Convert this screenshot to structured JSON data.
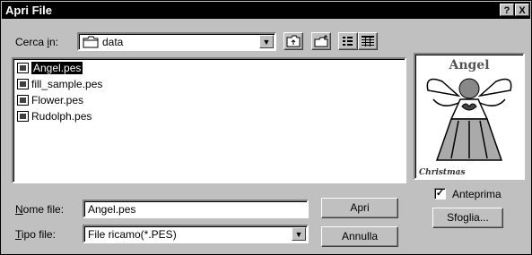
{
  "window": {
    "title": "Apri File",
    "help_label": "?",
    "close_label": "X"
  },
  "lookin": {
    "label_pre": "Cerca ",
    "label_accel": "i",
    "label_post": "n:",
    "value": "data"
  },
  "files": [
    {
      "name": "Angel.pes",
      "selected": true
    },
    {
      "name": "fill_sample.pes",
      "selected": false
    },
    {
      "name": "Flower.pes",
      "selected": false
    },
    {
      "name": "Rudolph.pes",
      "selected": false
    }
  ],
  "filename": {
    "label_accel": "N",
    "label_rest": "ome file:",
    "value": "Angel.pes"
  },
  "filetype": {
    "label_accel": "T",
    "label_rest": "ipo file:",
    "value": "File ricamo(*.PES)"
  },
  "buttons": {
    "open": "Apri",
    "cancel": "Annulla",
    "browse": "Sfoglia..."
  },
  "preview": {
    "checkbox_label": "Anteprima",
    "checked": true,
    "image_text_top": "Angel",
    "image_text_bottom": "Christmas"
  }
}
